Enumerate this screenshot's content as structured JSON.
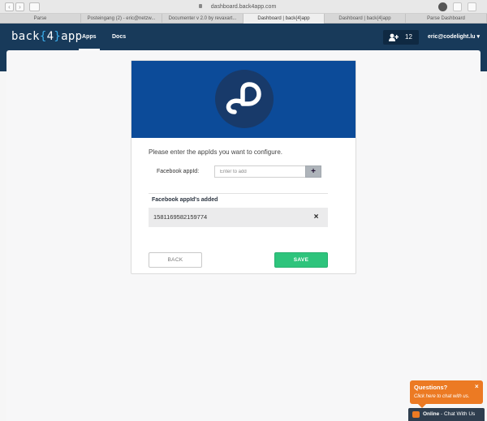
{
  "browser": {
    "url": "dashboard.back4app.com",
    "tabs": [
      {
        "label": "Parse",
        "active": false
      },
      {
        "label": "Posteingang (2) - eric@netzw...",
        "active": false
      },
      {
        "label": "Documenter v 2.0 by revaxart...",
        "active": false
      },
      {
        "label": "Dashboard | back{4}app",
        "active": true
      },
      {
        "label": "Dashboard | back{4}app",
        "active": false
      },
      {
        "label": "Parse Dashboard",
        "active": false
      }
    ]
  },
  "header": {
    "logo_prefix": "back",
    "logo_open": "{",
    "logo_number": "4",
    "logo_close": "}",
    "logo_suffix": "app",
    "nav": [
      {
        "label": "Apps",
        "active": true
      },
      {
        "label": "Docs",
        "active": false
      }
    ],
    "user_count": "12",
    "account": "eric@codelight.lu ▾"
  },
  "card": {
    "instruction": "Please enter the appIds you want to configure.",
    "field_label": "Facebook appId:",
    "field_placeholder": "Enter to add",
    "field_value": "",
    "add_symbol": "+",
    "added_title": "Facebook appId's added",
    "added_ids": [
      "1581169582159774"
    ],
    "remove_symbol": "×",
    "back_label": "BACK",
    "save_label": "SAVE"
  },
  "chat": {
    "title": "Questions?",
    "subtitle": "Click here to chat with us.",
    "close": "×",
    "status": "Online",
    "status_suffix": " - Chat With Us"
  },
  "colors": {
    "header_bg": "#183a5a",
    "hero_bg": "#0c4b99",
    "save_green": "#2ec47c",
    "chat_orange": "#ec7a23",
    "logo_accent": "#3db0ef"
  }
}
